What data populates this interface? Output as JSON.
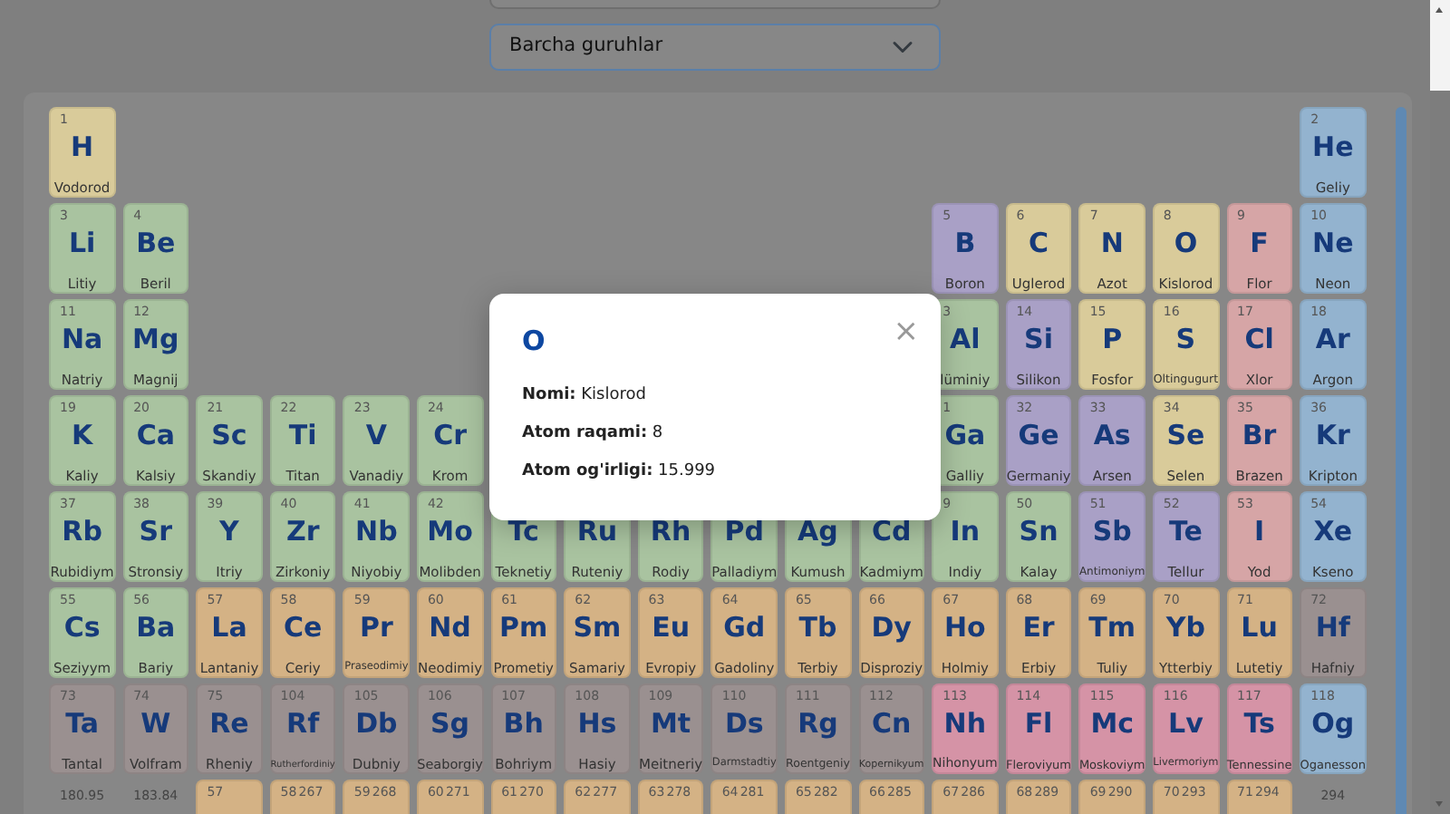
{
  "filters": {
    "group_select": {
      "value": "Barcha guruhlar"
    }
  },
  "table": {
    "rows": [
      [
        {
          "kind": "element",
          "number": "1",
          "symbol": "H",
          "name": "Vodorod",
          "color": "#d9cb9a"
        },
        {
          "kind": "gap"
        },
        {
          "kind": "gap"
        },
        {
          "kind": "gap"
        },
        {
          "kind": "gap"
        },
        {
          "kind": "gap"
        },
        {
          "kind": "gap"
        },
        {
          "kind": "gap"
        },
        {
          "kind": "gap"
        },
        {
          "kind": "gap"
        },
        {
          "kind": "gap"
        },
        {
          "kind": "gap"
        },
        {
          "kind": "gap"
        },
        {
          "kind": "gap"
        },
        {
          "kind": "gap"
        },
        {
          "kind": "gap"
        },
        {
          "kind": "gap"
        },
        {
          "kind": "element",
          "number": "2",
          "symbol": "He",
          "name": "Geliy",
          "color": "#93b3cf"
        }
      ],
      [
        {
          "kind": "element",
          "number": "3",
          "symbol": "Li",
          "name": "Litiy",
          "color": "#a9c3a0"
        },
        {
          "kind": "element",
          "number": "4",
          "symbol": "Be",
          "name": "Beril",
          "color": "#a9c3a0"
        },
        {
          "kind": "gap"
        },
        {
          "kind": "gap"
        },
        {
          "kind": "gap"
        },
        {
          "kind": "gap"
        },
        {
          "kind": "gap"
        },
        {
          "kind": "gap"
        },
        {
          "kind": "gap"
        },
        {
          "kind": "gap"
        },
        {
          "kind": "gap"
        },
        {
          "kind": "gap"
        },
        {
          "kind": "element",
          "number": "5",
          "symbol": "B",
          "name": "Boron",
          "color": "#a9a0c6"
        },
        {
          "kind": "element",
          "number": "6",
          "symbol": "C",
          "name": "Uglerod",
          "color": "#d9cb9a"
        },
        {
          "kind": "element",
          "number": "7",
          "symbol": "N",
          "name": "Azot",
          "color": "#d9cb9a"
        },
        {
          "kind": "element",
          "number": "8",
          "symbol": "O",
          "name": "Kislorod",
          "color": "#d9cb9a"
        },
        {
          "kind": "element",
          "number": "9",
          "symbol": "F",
          "name": "Flor",
          "color": "#d6a5a6"
        },
        {
          "kind": "element",
          "number": "10",
          "symbol": "Ne",
          "name": "Neon",
          "color": "#93b3cf"
        }
      ],
      [
        {
          "kind": "element",
          "number": "11",
          "symbol": "Na",
          "name": "Natriy",
          "color": "#a9c3a0"
        },
        {
          "kind": "element",
          "number": "12",
          "symbol": "Mg",
          "name": "Magnij",
          "color": "#a9c3a0"
        },
        {
          "kind": "gap"
        },
        {
          "kind": "gap"
        },
        {
          "kind": "gap"
        },
        {
          "kind": "gap"
        },
        {
          "kind": "gap"
        },
        {
          "kind": "gap"
        },
        {
          "kind": "gap"
        },
        {
          "kind": "gap"
        },
        {
          "kind": "gap"
        },
        {
          "kind": "gap"
        },
        {
          "kind": "element",
          "number": "3",
          "symbol": "Al",
          "name": "lüminiy",
          "color": "#a9c3a0"
        },
        {
          "kind": "element",
          "number": "14",
          "symbol": "Si",
          "name": "Silikon",
          "color": "#a9a0c6"
        },
        {
          "kind": "element",
          "number": "15",
          "symbol": "P",
          "name": "Fosfor",
          "color": "#d9cb9a"
        },
        {
          "kind": "element",
          "number": "16",
          "symbol": "S",
          "name": "Oltingugurt",
          "color": "#d9cb9a"
        },
        {
          "kind": "element",
          "number": "17",
          "symbol": "Cl",
          "name": "Xlor",
          "color": "#d6a5a6"
        },
        {
          "kind": "element",
          "number": "18",
          "symbol": "Ar",
          "name": "Argon",
          "color": "#93b3cf"
        }
      ],
      [
        {
          "kind": "element",
          "number": "19",
          "symbol": "K",
          "name": "Kaliy",
          "color": "#a9c3a0"
        },
        {
          "kind": "element",
          "number": "20",
          "symbol": "Ca",
          "name": "Kalsiy",
          "color": "#a9c3a0"
        },
        {
          "kind": "element",
          "number": "21",
          "symbol": "Sc",
          "name": "Skandiy",
          "color": "#a9c3a0"
        },
        {
          "kind": "element",
          "number": "22",
          "symbol": "Ti",
          "name": "Titan",
          "color": "#a9c3a0"
        },
        {
          "kind": "element",
          "number": "23",
          "symbol": "V",
          "name": "Vanadiy",
          "color": "#a9c3a0"
        },
        {
          "kind": "element",
          "number": "24",
          "symbol": "Cr",
          "name": "Krom",
          "color": "#a9c3a0"
        },
        {
          "kind": "gap"
        },
        {
          "kind": "gap"
        },
        {
          "kind": "gap"
        },
        {
          "kind": "gap"
        },
        {
          "kind": "gap"
        },
        {
          "kind": "gap"
        },
        {
          "kind": "element",
          "number": "1",
          "symbol": "Ga",
          "name": "Galliy",
          "color": "#a9c3a0"
        },
        {
          "kind": "element",
          "number": "32",
          "symbol": "Ge",
          "name": "Germaniy",
          "color": "#a9a0c6"
        },
        {
          "kind": "element",
          "number": "33",
          "symbol": "As",
          "name": "Arsen",
          "color": "#a9a0c6"
        },
        {
          "kind": "element",
          "number": "34",
          "symbol": "Se",
          "name": "Selen",
          "color": "#d9cb9a"
        },
        {
          "kind": "element",
          "number": "35",
          "symbol": "Br",
          "name": "Brazen",
          "color": "#d6a5a6"
        },
        {
          "kind": "element",
          "number": "36",
          "symbol": "Kr",
          "name": "Kripton",
          "color": "#93b3cf"
        }
      ],
      [
        {
          "kind": "element",
          "number": "37",
          "symbol": "Rb",
          "name": "Rubidiym",
          "color": "#a9c3a0"
        },
        {
          "kind": "element",
          "number": "38",
          "symbol": "Sr",
          "name": "Stronsiy",
          "color": "#a9c3a0"
        },
        {
          "kind": "element",
          "number": "39",
          "symbol": "Y",
          "name": "Itriy",
          "color": "#a9c3a0"
        },
        {
          "kind": "element",
          "number": "40",
          "symbol": "Zr",
          "name": "Zirkoniy",
          "color": "#a9c3a0"
        },
        {
          "kind": "element",
          "number": "41",
          "symbol": "Nb",
          "name": "Niyobiy",
          "color": "#a9c3a0"
        },
        {
          "kind": "element",
          "number": "42",
          "symbol": "Mo",
          "name": "Molibden",
          "color": "#a9c3a0"
        },
        {
          "kind": "element",
          "symbol": "Tc",
          "name": "Teknetiy",
          "color": "#a9c3a0"
        },
        {
          "kind": "element",
          "symbol": "Ru",
          "name": "Ruteniy",
          "color": "#a9c3a0"
        },
        {
          "kind": "element",
          "symbol": "Rh",
          "name": "Rodiy",
          "color": "#a9c3a0"
        },
        {
          "kind": "element",
          "symbol": "Pd",
          "name": "Palladiym",
          "color": "#a9c3a0"
        },
        {
          "kind": "element",
          "symbol": "Ag",
          "name": "Kumush",
          "color": "#a9c3a0"
        },
        {
          "kind": "element",
          "symbol": "Cd",
          "name": "Kadmiym",
          "color": "#a9c3a0"
        },
        {
          "kind": "element",
          "number": "9",
          "symbol": "In",
          "name": "Indiy",
          "color": "#a9c3a0"
        },
        {
          "kind": "element",
          "number": "50",
          "symbol": "Sn",
          "name": "Kalay",
          "color": "#a9c3a0"
        },
        {
          "kind": "element",
          "number": "51",
          "symbol": "Sb",
          "name": "Antimoniym",
          "color": "#a9a0c6"
        },
        {
          "kind": "element",
          "number": "52",
          "symbol": "Te",
          "name": "Tellur",
          "color": "#a9a0c6"
        },
        {
          "kind": "element",
          "number": "53",
          "symbol": "I",
          "name": "Yod",
          "color": "#d6a5a6"
        },
        {
          "kind": "element",
          "number": "54",
          "symbol": "Xe",
          "name": "Kseno",
          "color": "#93b3cf"
        }
      ],
      [
        {
          "kind": "element",
          "number": "55",
          "symbol": "Cs",
          "name": "Seziyym",
          "color": "#a9c3a0"
        },
        {
          "kind": "element",
          "number": "56",
          "symbol": "Ba",
          "name": "Bariy",
          "color": "#a9c3a0"
        },
        {
          "kind": "element",
          "number": "57",
          "symbol": "La",
          "name": "Lantaniy",
          "color": "#d4b285"
        },
        {
          "kind": "element",
          "number": "58",
          "symbol": "Ce",
          "name": "Ceriy",
          "color": "#d4b285"
        },
        {
          "kind": "element",
          "number": "59",
          "symbol": "Pr",
          "name": "Praseodimiy",
          "color": "#d4b285"
        },
        {
          "kind": "element",
          "number": "60",
          "symbol": "Nd",
          "name": "Neodimiy",
          "color": "#d4b285"
        },
        {
          "kind": "element",
          "number": "61",
          "symbol": "Pm",
          "name": "Prometiy",
          "color": "#d4b285"
        },
        {
          "kind": "element",
          "number": "62",
          "symbol": "Sm",
          "name": "Samariy",
          "color": "#d4b285"
        },
        {
          "kind": "element",
          "number": "63",
          "symbol": "Eu",
          "name": "Evropiy",
          "color": "#d4b285"
        },
        {
          "kind": "element",
          "number": "64",
          "symbol": "Gd",
          "name": "Gadoliny",
          "color": "#d4b285"
        },
        {
          "kind": "element",
          "number": "65",
          "symbol": "Tb",
          "name": "Terbiy",
          "color": "#d4b285"
        },
        {
          "kind": "element",
          "number": "66",
          "symbol": "Dy",
          "name": "Disproziy",
          "color": "#d4b285"
        },
        {
          "kind": "element",
          "number": "67",
          "symbol": "Ho",
          "name": "Holmiy",
          "color": "#d4b285"
        },
        {
          "kind": "element",
          "number": "68",
          "symbol": "Er",
          "name": "Erbiy",
          "color": "#d4b285"
        },
        {
          "kind": "element",
          "number": "69",
          "symbol": "Tm",
          "name": "Tuliy",
          "color": "#d4b285"
        },
        {
          "kind": "element",
          "number": "70",
          "symbol": "Yb",
          "name": "Ytterbiy",
          "color": "#d4b285"
        },
        {
          "kind": "element",
          "number": "71",
          "symbol": "Lu",
          "name": "Lutetiy",
          "color": "#d4b285"
        },
        {
          "kind": "element",
          "number": "72",
          "symbol": "Hf",
          "name": "Hafniy",
          "color": "#9a9090"
        }
      ],
      [
        {
          "kind": "element",
          "number": "73",
          "symbol": "Ta",
          "name": "Tantal",
          "color": "#9a9090"
        },
        {
          "kind": "element",
          "number": "74",
          "symbol": "W",
          "name": "Volfram",
          "color": "#9a9090"
        },
        {
          "kind": "element",
          "number": "75",
          "symbol": "Re",
          "name": "Rheniy",
          "color": "#9a9090"
        },
        {
          "kind": "element",
          "number": "104",
          "symbol": "Rf",
          "name": "Rutherfordiniy",
          "color": "#9a9090"
        },
        {
          "kind": "element",
          "number": "105",
          "symbol": "Db",
          "name": "Dubniy",
          "color": "#9a9090"
        },
        {
          "kind": "element",
          "number": "106",
          "symbol": "Sg",
          "name": "Seaborgiy",
          "color": "#9a9090"
        },
        {
          "kind": "element",
          "number": "107",
          "symbol": "Bh",
          "name": "Bohriym",
          "color": "#9a9090"
        },
        {
          "kind": "element",
          "number": "108",
          "symbol": "Hs",
          "name": "Hasiy",
          "color": "#9a9090"
        },
        {
          "kind": "element",
          "number": "109",
          "symbol": "Mt",
          "name": "Meitneriy",
          "color": "#9a9090"
        },
        {
          "kind": "element",
          "number": "110",
          "symbol": "Ds",
          "name": "Darmstadtiy",
          "color": "#9a9090"
        },
        {
          "kind": "element",
          "number": "111",
          "symbol": "Rg",
          "name": "Roentgeniy",
          "color": "#9a9090"
        },
        {
          "kind": "element",
          "number": "112",
          "symbol": "Cn",
          "name": "Kopernikyum",
          "color": "#9a9090"
        },
        {
          "kind": "element",
          "number": "113",
          "symbol": "Nh",
          "name": "Nihonyum",
          "color": "#d593a6"
        },
        {
          "kind": "element",
          "number": "114",
          "symbol": "Fl",
          "name": "Fleroviyum",
          "color": "#d593a6"
        },
        {
          "kind": "element",
          "number": "115",
          "symbol": "Mc",
          "name": "Moskoviym",
          "color": "#d593a6"
        },
        {
          "kind": "element",
          "number": "116",
          "symbol": "Lv",
          "name": "Livermoriym",
          "color": "#d593a6"
        },
        {
          "kind": "element",
          "number": "117",
          "symbol": "Ts",
          "name": "Tennessine",
          "color": "#d593a6"
        },
        {
          "kind": "element",
          "number": "118",
          "symbol": "Og",
          "name": "Oganesson",
          "color": "#93b3cf"
        }
      ],
      [
        {
          "kind": "weight",
          "weight": "180.95"
        },
        {
          "kind": "weight",
          "weight": "183.84"
        },
        {
          "kind": "element",
          "number": "57",
          "color": "#d4b285"
        },
        {
          "kind": "element",
          "number": "58",
          "weight": "267",
          "color": "#d4b285"
        },
        {
          "kind": "element",
          "number": "59",
          "weight": "268",
          "color": "#d4b285"
        },
        {
          "kind": "element",
          "number": "60",
          "weight": "271",
          "color": "#d4b285"
        },
        {
          "kind": "element",
          "number": "61",
          "weight": "270",
          "color": "#d4b285"
        },
        {
          "kind": "element",
          "number": "62",
          "weight": "277",
          "color": "#d4b285"
        },
        {
          "kind": "element",
          "number": "63",
          "weight": "278",
          "color": "#d4b285"
        },
        {
          "kind": "element",
          "number": "64",
          "weight": "281",
          "color": "#d4b285"
        },
        {
          "kind": "element",
          "number": "65",
          "weight": "282",
          "color": "#d4b285"
        },
        {
          "kind": "element",
          "number": "66",
          "weight": "285",
          "color": "#d4b285"
        },
        {
          "kind": "element",
          "number": "67",
          "weight": "286",
          "color": "#d4b285"
        },
        {
          "kind": "element",
          "number": "68",
          "weight": "289",
          "color": "#d4b285"
        },
        {
          "kind": "element",
          "number": "69",
          "weight": "290",
          "color": "#d4b285"
        },
        {
          "kind": "element",
          "number": "70",
          "weight": "293",
          "color": "#d4b285"
        },
        {
          "kind": "element",
          "number": "71",
          "weight": "294",
          "color": "#d4b285"
        },
        {
          "kind": "weight",
          "weight": "294"
        }
      ]
    ]
  },
  "modal": {
    "title": "O",
    "close": "×",
    "lines": [
      "**Nomi:** Kislorod",
      "**Atom raqami:** 8",
      "**Atom og'irligi:** 15.999"
    ]
  }
}
